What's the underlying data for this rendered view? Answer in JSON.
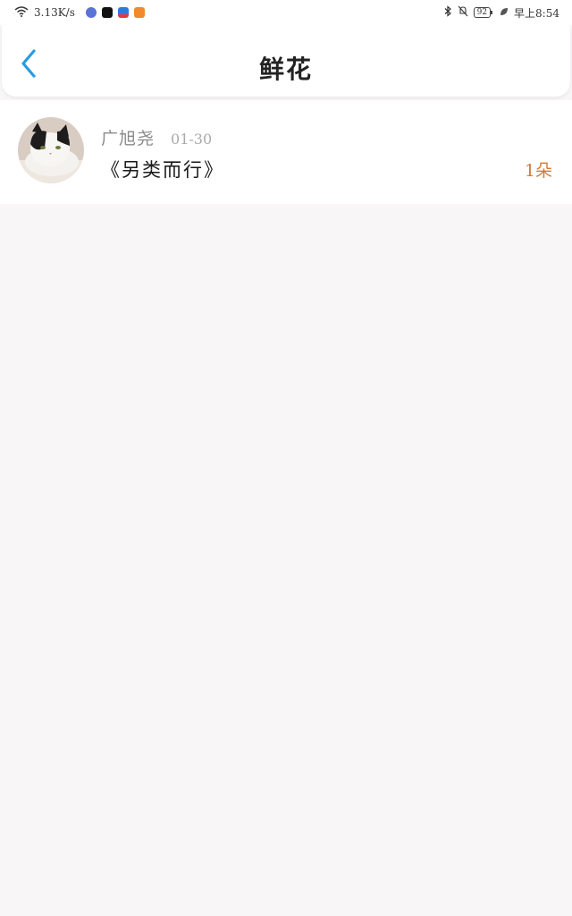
{
  "status_bar": {
    "network_speed": "3.13K/s",
    "battery_level": "92",
    "time": "早上8:54",
    "app_icons": [
      {
        "name": "music-app-icon",
        "color": "#5b73d6"
      },
      {
        "name": "tiktok-app-icon",
        "color": "#111111"
      },
      {
        "name": "shopping-app-icon",
        "color": "#e33b3b"
      },
      {
        "name": "video-app-icon",
        "color": "#f08a2c"
      }
    ]
  },
  "header": {
    "title": "鲜花",
    "back_icon": "chevron-left-icon",
    "accent_color": "#2a9bde"
  },
  "records": [
    {
      "user_name": "广旭尧",
      "date": "01-30",
      "gift_title": "《另类而行》",
      "count": "1朵"
    }
  ],
  "colors": {
    "background": "#f8f6f7",
    "count_color": "#d67a38"
  }
}
